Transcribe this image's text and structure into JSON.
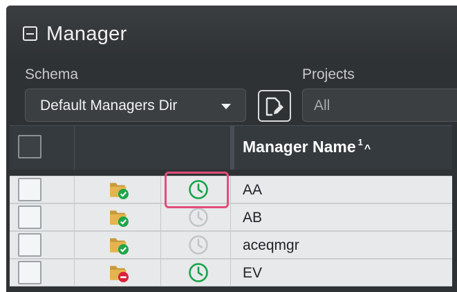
{
  "window": {
    "title": "Manager"
  },
  "schema": {
    "label": "Schema",
    "value": "Default Managers Dir"
  },
  "projects": {
    "label": "Projects",
    "value": "All"
  },
  "grid": {
    "name_column": "Manager Name",
    "sort_index": "1",
    "sort_direction_glyph": "^",
    "rows": [
      {
        "name": "AA",
        "folder_status": "ok",
        "clock_active": true
      },
      {
        "name": "AB",
        "folder_status": "ok",
        "clock_active": false
      },
      {
        "name": "aceqmgr",
        "folder_status": "ok",
        "clock_active": false
      },
      {
        "name": "EV",
        "folder_status": "error",
        "clock_active": true
      }
    ]
  },
  "colors": {
    "highlight": "#e24d7a",
    "clock_active": "#17a34a",
    "clock_inactive": "#c3c6c9",
    "status_ok": "#1fa64a",
    "status_error": "#d9213a"
  },
  "icons": {
    "collapse": "collapse-icon",
    "edit": "edit-document-icon",
    "folder_ok": "folder-check-icon",
    "folder_error": "folder-error-icon",
    "clock": "clock-icon"
  }
}
